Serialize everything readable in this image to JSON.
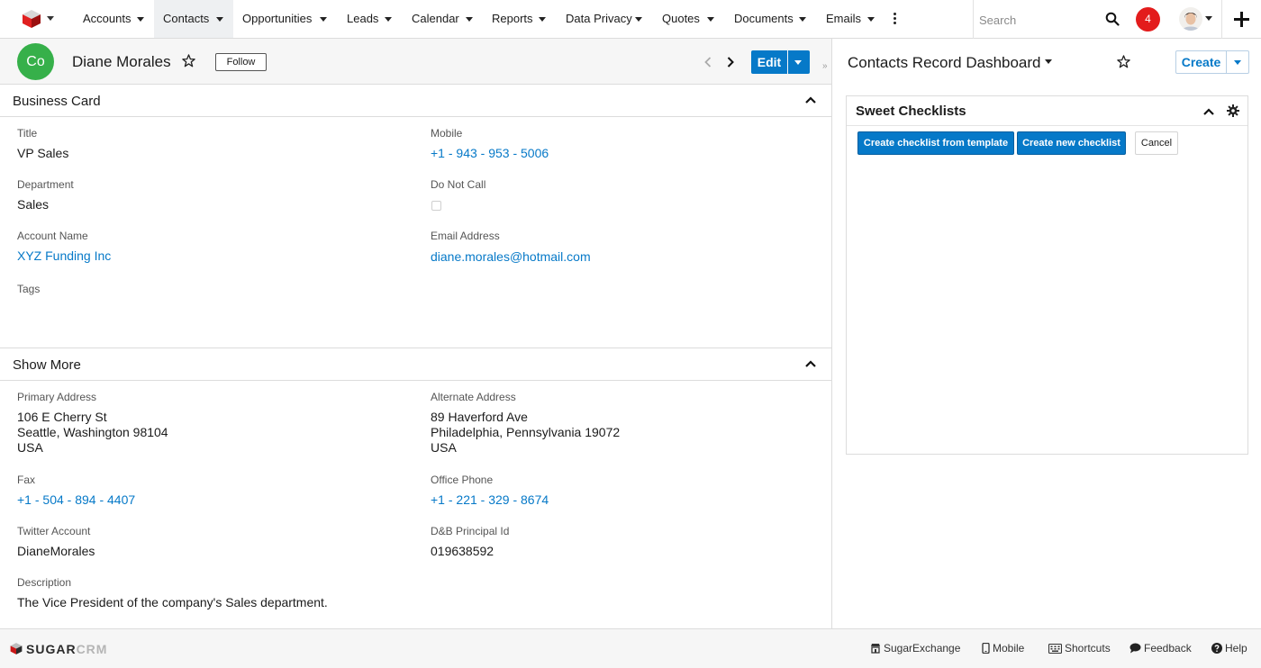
{
  "nav": {
    "tabs": [
      "Accounts",
      "Contacts",
      "Opportunities",
      "Leads",
      "Calendar",
      "Reports",
      "Data Privacy",
      "Quotes",
      "Documents",
      "Emails"
    ],
    "active_tab": "Contacts",
    "search_placeholder": "Search",
    "notification_count": "4"
  },
  "record": {
    "module_badge": "Co",
    "name": "Diane Morales",
    "follow_label": "Follow",
    "edit_label": "Edit"
  },
  "business_card": {
    "heading": "Business Card",
    "title_label": "Title",
    "title_value": "VP Sales",
    "mobile_label": "Mobile",
    "mobile_value": "+1 - 943 - 953 - 5006",
    "department_label": "Department",
    "department_value": "Sales",
    "do_not_call_label": "Do Not Call",
    "do_not_call_checked": false,
    "account_label": "Account Name",
    "account_value": "XYZ Funding Inc",
    "email_label": "Email Address",
    "email_value": "diane.morales@hotmail.com",
    "tags_label": "Tags"
  },
  "show_more": {
    "heading": "Show More",
    "primary_address_label": "Primary Address",
    "primary_address_line1": "106 E Cherry St",
    "primary_address_line2": "Seattle, Washington 98104",
    "primary_address_line3": "USA",
    "alternate_address_label": "Alternate Address",
    "alternate_address_line1": "89 Haverford Ave",
    "alternate_address_line2": "Philadelphia, Pennsylvania 19072",
    "alternate_address_line3": "USA",
    "fax_label": "Fax",
    "fax_value": "+1 - 504 - 894 - 4407",
    "office_phone_label": "Office Phone",
    "office_phone_value": "+1 - 221 - 329 - 8674",
    "twitter_label": "Twitter Account",
    "twitter_value": "DianeMorales",
    "dnb_label": "D&B Principal Id",
    "dnb_value": "019638592",
    "description_label": "Description",
    "description_value": "The Vice President of the company's Sales department."
  },
  "dashboard": {
    "title": "Contacts Record Dashboard",
    "create_label": "Create",
    "dashlet_title": "Sweet Checklists",
    "btn_from_template": "Create checklist from template",
    "btn_new_checklist": "Create new checklist",
    "btn_cancel": "Cancel"
  },
  "footer": {
    "logo_sugar": "SUGAR",
    "logo_crm": "CRM",
    "links": [
      "SugarExchange",
      "Mobile",
      "Shortcuts",
      "Feedback",
      "Help"
    ]
  },
  "colors": {
    "accent_blue": "#0679c8",
    "badge_green": "#36b04a",
    "notification_red": "#e31c1c"
  }
}
